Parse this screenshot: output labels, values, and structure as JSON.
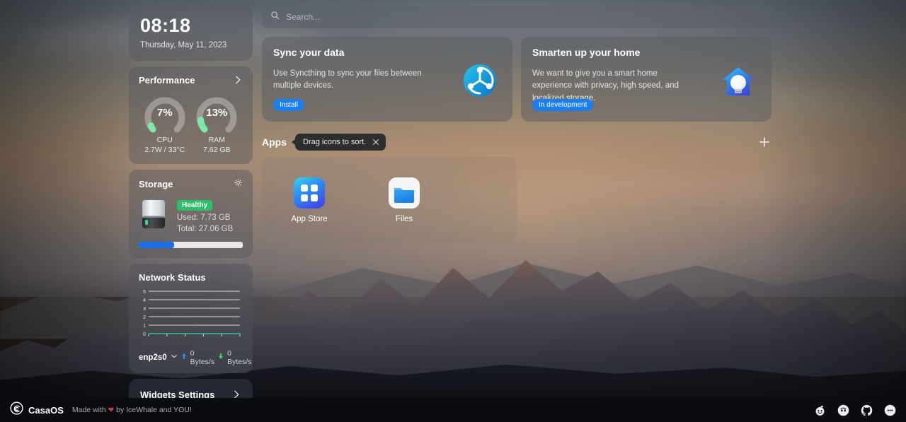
{
  "clock": {
    "time": "08:18",
    "date": "Thursday, May 11, 2023"
  },
  "performance": {
    "title": "Performance",
    "chevron_icon": "chevron-right-icon",
    "gauges": [
      {
        "label": "CPU",
        "value_text": "7%",
        "percent": 7,
        "sub": "2.7W / 33°C"
      },
      {
        "label": "RAM",
        "value_text": "13%",
        "percent": 13,
        "sub": "7.62 GB"
      }
    ]
  },
  "storage": {
    "title": "Storage",
    "settings_icon": "gear-icon",
    "drive_icon": "hard-drive-icon",
    "status_badge": "Healthy",
    "used_label": "Used: 7.73 GB",
    "total_label": "Total: 27.06 GB",
    "used_percent": 34,
    "bar_color": "#1a6fe8",
    "badge_color": "#2fbf6a"
  },
  "network": {
    "title": "Network Status",
    "interface": "enp2s0",
    "dropdown_icon": "chevron-down-icon",
    "upload_icon": "arrow-up-icon",
    "upload_rate": "0 Bytes/s",
    "download_icon": "arrow-down-icon",
    "download_rate": "0 Bytes/s",
    "chart_data": {
      "type": "line",
      "title": "Network Status",
      "xlabel": "",
      "ylabel": "",
      "ylim": [
        0,
        5
      ],
      "ytick_labels": [
        "0",
        "1",
        "2",
        "3",
        "4",
        "5"
      ],
      "grid": true,
      "legend_position": "bottom",
      "x": [
        0,
        1,
        2,
        3,
        4,
        5
      ],
      "series": [
        {
          "name": "Upload",
          "color": "#2b8fff",
          "values": [
            0,
            0,
            0,
            0,
            0,
            0
          ]
        },
        {
          "name": "Download",
          "color": "#38d07a",
          "values": [
            0,
            0,
            0,
            0,
            0,
            0
          ]
        }
      ]
    }
  },
  "widgets_settings": {
    "label": "Widgets Settings",
    "chevron_icon": "chevron-right-icon"
  },
  "search": {
    "placeholder": "Search...",
    "icon": "search-icon",
    "value": ""
  },
  "promos": [
    {
      "title": "Sync your data",
      "description": "Use Syncthing to sync your files between multiple devices.",
      "button_label": "Install",
      "icon": "syncthing-logo-icon"
    },
    {
      "title": "Smarten up your home",
      "description": "We want to give you a smart home experience with privacy, high speed, and localized storage.",
      "button_label": "In development",
      "icon": "smart-home-icon"
    }
  ],
  "apps": {
    "title": "Apps",
    "tooltip_text": "Drag icons to sort.",
    "tooltip_close_icon": "close-icon",
    "add_icon": "plus-icon",
    "items": [
      {
        "name": "App Store",
        "icon": "app-store-icon"
      },
      {
        "name": "Files",
        "icon": "files-folder-icon"
      }
    ]
  },
  "footer": {
    "logo_icon": "casaos-whale-icon",
    "brand": "CasaOS",
    "made_prefix": "Made with",
    "heart_icon": "heart-icon",
    "made_suffix": "by IceWhale and YOU!",
    "socials": [
      {
        "name": "reddit-icon"
      },
      {
        "name": "discord-icon"
      },
      {
        "name": "github-icon"
      },
      {
        "name": "forum-icon"
      }
    ]
  }
}
